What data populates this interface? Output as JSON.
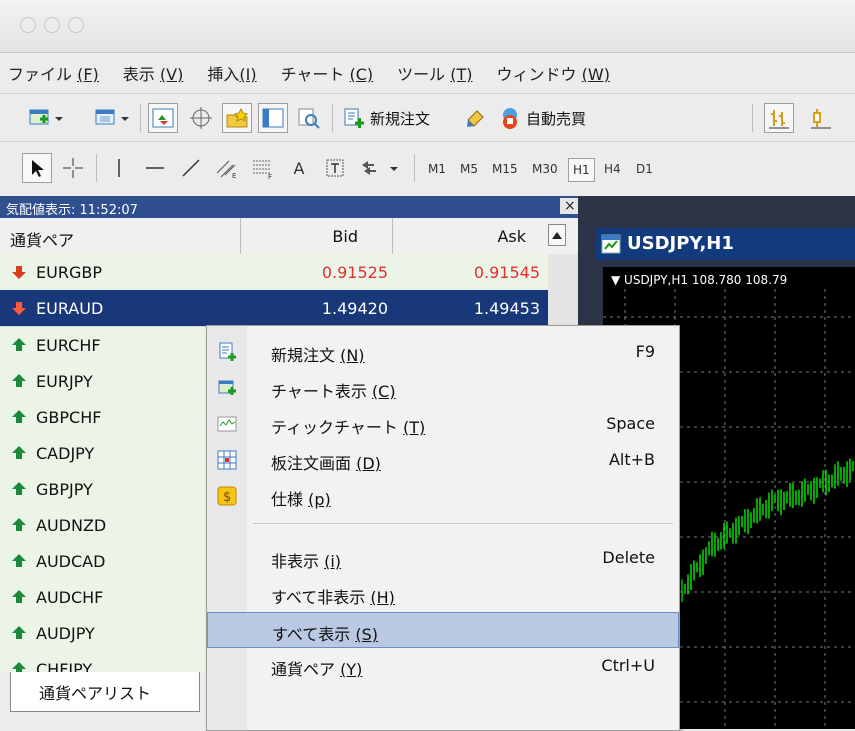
{
  "colors": {
    "selection": "#18387a",
    "panel_title": "#2f4f8f",
    "bid_red": "#e03030",
    "chart_bg": "#000000",
    "candle_green": "#00e000"
  },
  "menubar": [
    {
      "label": "ファイル",
      "key": "(F)"
    },
    {
      "label": "表示",
      "key": "(V)"
    },
    {
      "label": "挿入",
      "key": "(I)"
    },
    {
      "label": "チャート",
      "key": "(C)"
    },
    {
      "label": "ツール",
      "key": "(T)"
    },
    {
      "label": "ウィンドウ",
      "key": "(W)"
    }
  ],
  "toolbar1": {
    "new_order": "新規注文",
    "auto_trade": "自動売買"
  },
  "toolbar2": {
    "letter_a": "A",
    "timeframes": [
      "M1",
      "M5",
      "M15",
      "M30",
      "H1",
      "H4",
      "D1"
    ],
    "active_timeframe": "H1"
  },
  "market_watch": {
    "title": "気配値表示: 11:52:07",
    "close": "×",
    "headers": {
      "symbol": "通貨ペア",
      "bid": "Bid",
      "ask": "Ask"
    },
    "rows": [
      {
        "symbol": "EURGBP",
        "bid": "0.91525",
        "ask": "0.91545",
        "dir": "down"
      },
      {
        "symbol": "EURAUD",
        "bid": "1.49420",
        "ask": "1.49453",
        "dir": "down"
      },
      {
        "symbol": "EURCHF",
        "dir": "up"
      },
      {
        "symbol": "EURJPY",
        "dir": "up"
      },
      {
        "symbol": "GBPCHF",
        "dir": "up"
      },
      {
        "symbol": "CADJPY",
        "dir": "up"
      },
      {
        "symbol": "GBPJPY",
        "dir": "up"
      },
      {
        "symbol": "AUDNZD",
        "dir": "up"
      },
      {
        "symbol": "AUDCAD",
        "dir": "up"
      },
      {
        "symbol": "AUDCHF",
        "dir": "up"
      },
      {
        "symbol": "AUDJPY",
        "dir": "up"
      },
      {
        "symbol": "CHFJPY",
        "dir": "up"
      }
    ],
    "tab": "通貨ペアリスト"
  },
  "chart": {
    "title": "USDJPY,H1",
    "info": "▼ USDJPY,H1  108.780  108.79"
  },
  "context_menu": [
    {
      "label": "新規注文",
      "key": "(N)",
      "shortcut": "F9",
      "icon": "new-order-icon"
    },
    {
      "label": "チャート表示",
      "key": "(C)",
      "shortcut": "",
      "icon": "chart-window-icon"
    },
    {
      "label": "ティックチャート",
      "key": "(T)",
      "shortcut": "Space",
      "icon": "tick-chart-icon"
    },
    {
      "label": "板注文画面",
      "key": "(D)",
      "shortcut": "Alt+B",
      "icon": "depth-of-market-icon"
    },
    {
      "label": "仕様",
      "key": "(p)",
      "shortcut": "",
      "icon": "specification-icon"
    },
    {
      "label": "非表示",
      "key": "(i)",
      "shortcut": "Delete",
      "icon": ""
    },
    {
      "label": "すべて非表示",
      "key": "(H)",
      "shortcut": "",
      "icon": ""
    },
    {
      "label": "すべて表示",
      "key": "(S)",
      "shortcut": "",
      "icon": ""
    },
    {
      "label": "通貨ペア",
      "key": "(Y)",
      "shortcut": "Ctrl+U",
      "icon": ""
    }
  ]
}
